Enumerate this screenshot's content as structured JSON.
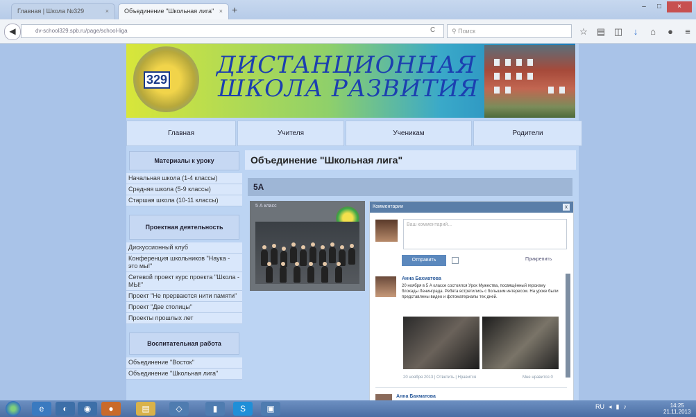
{
  "browser": {
    "tabs": [
      {
        "label": "Главная | Школа №329"
      },
      {
        "label": "Объединение \"Школьная лига\""
      }
    ],
    "new_tab": "+",
    "url": "dv-school329.spb.ru/page/school-liga",
    "search_placeholder": "Поиск",
    "back": "◀",
    "reload": "C"
  },
  "banner": {
    "logo_number": "329",
    "title_line1": "ДИСТАНЦИОННАЯ",
    "title_line2": "ШКОЛА РАЗВИТИЯ"
  },
  "menu": [
    {
      "label": "Главная"
    },
    {
      "label": "Учителя"
    },
    {
      "label": "Ученикам"
    },
    {
      "label": "Родители"
    }
  ],
  "sidebar": {
    "groups": [
      {
        "title": "Материалы к уроку",
        "items": [
          "Начальная школа (1-4 классы)",
          "Средняя школа (5-9 классы)",
          "Старшая школа (10-11 классы)"
        ]
      },
      {
        "title": "Проектная деятельность",
        "items": [
          "Дискуссионный клуб",
          "Конференция школьников \"Наука - это мы!\"",
          "Сетевой проект курс проекта \"Школа - МЫ!\"",
          "Проект \"Не прерваются нити памяти\"",
          "Проект \"Две столицы\"",
          "Проекты прошлых лет"
        ]
      },
      {
        "title": "Воспитательная работа",
        "items": [
          "Объединение \"Восток\"",
          "Объединение \"Школьная лига\""
        ]
      }
    ]
  },
  "content": {
    "title": "Объединение \"Школьная лига\"",
    "section": "5А",
    "photo_caption": "5 А класс"
  },
  "comments": {
    "header": "Комментарии",
    "close": "x",
    "input_placeholder": "Ваш комментарий...",
    "send_label": "Отправить",
    "subscribe_label": "Прикрепить",
    "post": {
      "author": "Анна Бахматова",
      "text": "20 ноября в 5 А классе состоялся Урок Мужества, посвящённый героизму блокады Ленинграда. Ребята встретились с большим интересом. На уроке были представлены видео и фотоматериалы тех дней.",
      "meta": "20 ноября 2013 | Ответить | Нравится",
      "meta2": "Мне нравится 0"
    },
    "next_author": "Анна Бахматова"
  },
  "taskbar": {
    "apps": [
      "e",
      "◐",
      "◉",
      "●",
      "▤",
      "◇",
      "▮",
      "S",
      "▣"
    ],
    "tray": [
      "RU",
      "◂",
      "▮",
      "♪"
    ],
    "time": "14:25",
    "date": "21.11.2013"
  },
  "colors": {
    "accent": "#5b88bd",
    "page_bg": "#a9c3e8",
    "menu_bg": "#d6e5fa"
  }
}
